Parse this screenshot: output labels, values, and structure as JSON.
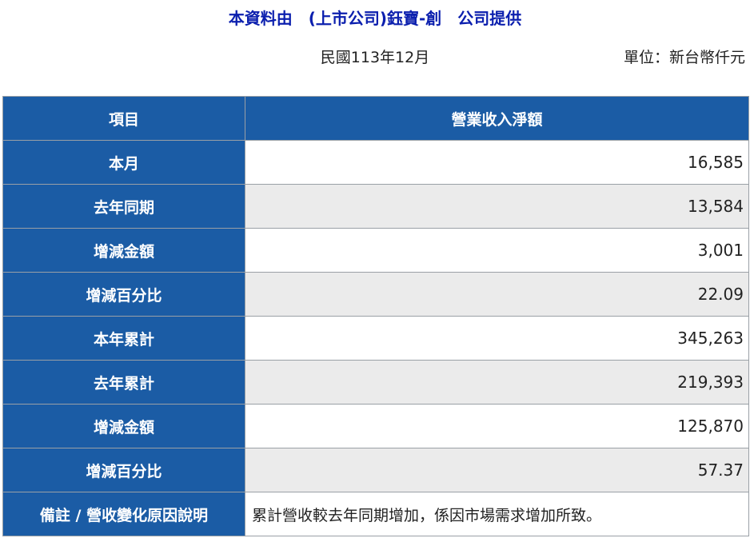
{
  "header": {
    "title": "本資料由　(上市公司)鈺寶-創　公司提供",
    "period": "民國113年12月",
    "unit": "單位：新台幣仟元"
  },
  "table": {
    "col_item": "項目",
    "col_value": "營業收入淨額",
    "rows": [
      {
        "label": "本月",
        "value": "16,585"
      },
      {
        "label": "去年同期",
        "value": "13,584"
      },
      {
        "label": "增減金額",
        "value": "3,001"
      },
      {
        "label": "增減百分比",
        "value": "22.09"
      },
      {
        "label": "本年累計",
        "value": "345,263"
      },
      {
        "label": "去年累計",
        "value": "219,393"
      },
      {
        "label": "增減金額",
        "value": "125,870"
      },
      {
        "label": "增減百分比",
        "value": "57.37"
      }
    ],
    "note": {
      "label": "備註 / 營收變化原因說明",
      "value": "累計營收較去年同期增加，係因市場需求增加所致。"
    }
  }
}
